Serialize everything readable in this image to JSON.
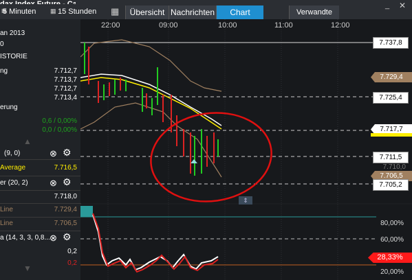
{
  "topbar": {
    "title": "dax Index Future - Cash",
    "interval1": "5 Minuten",
    "interval2": "15 Stunden",
    "tabs": [
      "Übersicht",
      "Nachrichten",
      "Chart"
    ],
    "related": "Verwandte",
    "colors": {
      "active_tab": "#1f8fd0"
    }
  },
  "panel": {
    "date": "an 2013",
    "zero": "0",
    "history": "ISTORIE",
    "rows": [
      {
        "label": "ng",
        "value": "7.712,7"
      },
      {
        "label": "",
        "value": "7.713,7"
      },
      {
        "label": "",
        "value": "7.712,7"
      },
      {
        "label": "",
        "value": "7.713,4"
      }
    ],
    "change_label": "erung",
    "changes": [
      "0,6 / 0,00%",
      "0,0 / 0,00%"
    ],
    "indicator1": "(9, 0)",
    "avg_label": "Average",
    "avg_value": "7.716,5",
    "indicator2": "er (20, 2)",
    "bb_value": "7.718,0",
    "line1_label": "Line",
    "line1_value": "7.729,4",
    "line2_label": "Line",
    "line2_value": "7.706,5",
    "stoch_label": "a (14, 3, 3, 0,8...",
    "stoch_value1": "0,2",
    "stoch_value2": "0,2"
  },
  "chart": {
    "time_labels": [
      "22:00",
      "09:00",
      "10:00",
      "11:00",
      "12:00"
    ],
    "prices": {
      "p1": "7.737,8",
      "p2": "7.729,4",
      "p3": "7.725,4",
      "p4": "7.717,7",
      "p5": "7.711,5",
      "p6": "7.710,0",
      "p7": "7.706,5",
      "p8": "7.705,2"
    },
    "osc_levels": [
      "80,00%",
      "60,00%",
      "20,00%"
    ],
    "osc_current": "28,33%",
    "colors": {
      "up": "#22cc22",
      "down": "#dd2222",
      "annotation": "#e01010",
      "price_ma": "#ffee00",
      "bb": "#a08060"
    }
  }
}
